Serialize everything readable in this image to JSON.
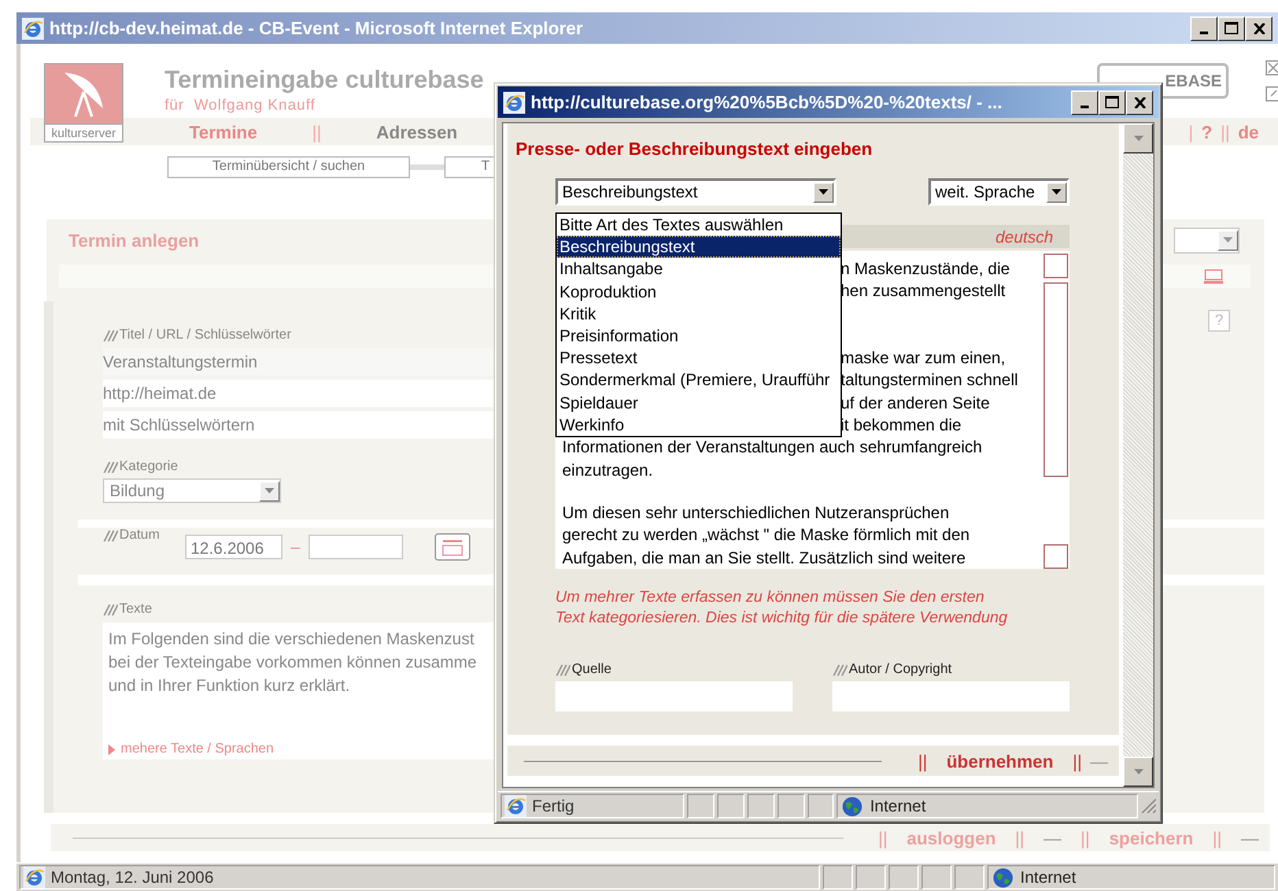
{
  "browser": {
    "title": "http://cb-dev.heimat.de - CB-Event - Microsoft Internet Explorer",
    "status_text": "Montag, 12. Juni 2006",
    "zone": "Internet"
  },
  "page": {
    "logo_caption": "kulturserver",
    "title": "Termineingabe culturebase",
    "subtitle": "für  Wolfgang Knauff",
    "brand_logo": "EBASE",
    "nav": [
      {
        "label": "Termine",
        "selected": true
      },
      {
        "label": "Adressen",
        "selected": false
      }
    ],
    "nav_separator": "||",
    "right_links": [
      {
        "separator": "|",
        "label": "?"
      },
      {
        "separator": "||",
        "label": "de"
      }
    ],
    "subnav": [
      "Terminübersicht / suchen",
      "T"
    ],
    "section_title": "Termin anlegen",
    "help_label": "?",
    "title_group": {
      "label": "Titel / URL / Schlüsselwörter",
      "fields": [
        "Veranstaltungstermin",
        "http://heimat.de",
        "mit Schlüsselwörtern"
      ]
    },
    "category": {
      "label": "Kategorie",
      "value": "Bildung"
    },
    "date": {
      "label": "Datum",
      "from": "12.6.2006",
      "separator": "–"
    },
    "texts": {
      "label": "Texte",
      "lines": [
        "Im Folgenden sind die verschiedenen Maskenzust",
        "bei der Texteingabe vorkommen können zusamme",
        "und in Ihrer Funktion kurz erklärt."
      ],
      "more_link": "mehere Texte / Sprachen"
    },
    "footer": {
      "separator": "||",
      "dash": "—",
      "links": [
        "ausloggen",
        "speichern"
      ]
    }
  },
  "popup": {
    "title": "http://culturebase.org%20%5Bcb%5D%20-%20texts/ - ...",
    "heading": "Presse- oder Beschreibungstext eingeben",
    "type_select": {
      "value": "Beschreibungstext",
      "expanded": true,
      "options": [
        {
          "label": "Bitte Art des Textes auswählen",
          "selected": false
        },
        {
          "label": "Beschreibungstext",
          "selected": true
        },
        {
          "label": "Inhaltsangabe",
          "selected": false
        },
        {
          "label": "Koproduktion",
          "selected": false
        },
        {
          "label": "Kritik",
          "selected": false
        },
        {
          "label": "Preisinformation",
          "selected": false
        },
        {
          "label": "Pressetext",
          "selected": false
        },
        {
          "label": "Sondermerkmal (Premiere, Uraufführ",
          "selected": false
        },
        {
          "label": "Spieldauer",
          "selected": false
        },
        {
          "label": "Werkinfo",
          "selected": false
        }
      ]
    },
    "language_select": {
      "value": "weit. Sprache"
    },
    "language_tab": "deutsch",
    "text_beside_list": [
      {
        "kind": "text",
        "text": "n Maskenzustände, die"
      },
      {
        "kind": "text",
        "text": "hen zusammengestellt"
      },
      {
        "kind": "blank"
      },
      {
        "kind": "blank"
      },
      {
        "kind": "text",
        "text": "maske war zum einen,"
      },
      {
        "kind": "text",
        "text": "taltungsterminen schnell"
      },
      {
        "kind": "text",
        "text": "uf der anderen Seite"
      },
      {
        "kind": "text",
        "text": "it bekommen die"
      }
    ],
    "text_lines": [
      {
        "kind": "text",
        "text": "Informationen der Veranstaltungen auch sehrumfangreich"
      },
      {
        "kind": "text",
        "text": "einzutragen."
      },
      {
        "kind": "blank"
      },
      {
        "kind": "text",
        "text": "Um diesen sehr unterschiedlichen Nutzeransprüchen"
      },
      {
        "kind": "text",
        "text": "gerecht zu werden „wächst \" die Maske förmlich mit den"
      },
      {
        "kind": "text",
        "text": "Aufgaben, die man an Sie stellt. Zusätzlich sind weitere"
      }
    ],
    "note_lines": [
      "Um mehrer Texte erfassen zu können müssen Sie den ersten",
      "Text kategoriesieren. Dies ist wichitg für die spätere Verwendung"
    ],
    "source": {
      "label": "Quelle"
    },
    "author": {
      "label": "Autor / Copyright"
    },
    "footer": {
      "separator": "||",
      "dash": "—",
      "action": "übernehmen"
    },
    "status": "Fertig",
    "zone": "Internet"
  }
}
